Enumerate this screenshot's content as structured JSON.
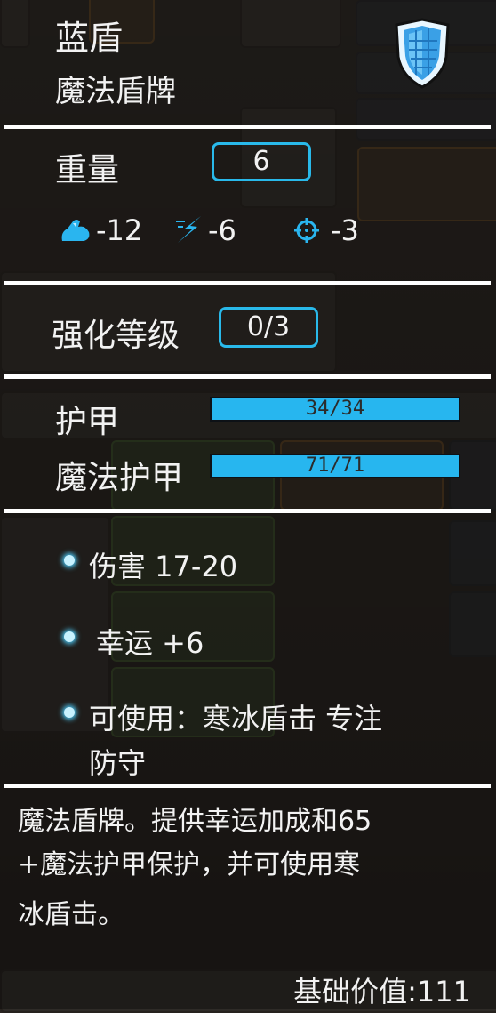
{
  "item": {
    "name": "蓝盾",
    "type": "魔法盾牌",
    "weight_label": "重量",
    "weight_value": "6",
    "penalties": {
      "strength": "-12",
      "agility": "-6",
      "accuracy": "-3"
    },
    "upgrade_label": "强化等级",
    "upgrade_value": "0/3",
    "armor_label": "护甲",
    "armor_value": "34/34",
    "armor_fill": 1.0,
    "magic_armor_label": "魔法护甲",
    "magic_armor_value": "71/71",
    "magic_armor_fill": 1.0,
    "stats": [
      "伤害 17-20",
      "幸运 +6",
      "可使用：寒冰盾击 专注",
      "防守"
    ],
    "description": [
      "魔法盾牌。提供幸运加成和65",
      "+魔法护甲保护，并可使用寒",
      "冰盾击。"
    ],
    "base_value": "基础价值:111"
  },
  "icons": {
    "shield": "shield-icon",
    "strength": "flexed-arm-icon",
    "agility": "lightning-runner-icon",
    "accuracy": "crosshair-icon"
  },
  "colors": {
    "accent": "#29b9ea",
    "bar_fill": "#27b6ef",
    "divider": "#ffffff"
  }
}
